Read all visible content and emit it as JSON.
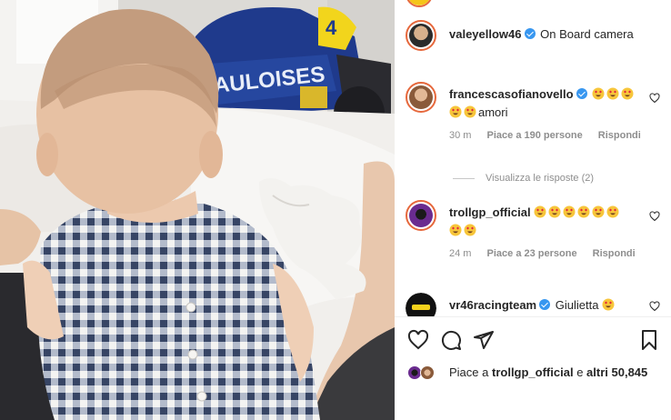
{
  "post": {
    "author": "valeyellow46",
    "caption": "On Board camera"
  },
  "comments": [
    {
      "username": "francescasofianovello",
      "text_line1_emojis": 3,
      "text_line2_emojis": 2,
      "text": "amori",
      "time": "30 m",
      "likes": "Piace a 190 persone",
      "reply": "Rispondi"
    },
    {
      "username": "trollgp_official",
      "text_line1_emojis": 6,
      "text_line2_emojis": 2,
      "text": "",
      "time": "24 m",
      "likes": "Piace a 23 persone",
      "reply": "Rispondi"
    },
    {
      "username": "vr46racingteam",
      "text": "Giulietta",
      "text_emojis": 1
    }
  ],
  "view_replies": "Visualizza le risposte (2)",
  "icons": [
    "heart-icon",
    "comment-icon",
    "share-icon",
    "bookmark-icon",
    "verified-badge-icon",
    "small-heart-icon",
    "heart-eyes-emoji"
  ],
  "likes": {
    "prefix": "Piace a",
    "user": "trollgp_official",
    "connector": "e",
    "others": "altri 50,845"
  },
  "colors": {
    "verified": "#3897f0",
    "muted": "#8e8e8e",
    "text": "#262626",
    "story_ring": "#e6683c"
  }
}
